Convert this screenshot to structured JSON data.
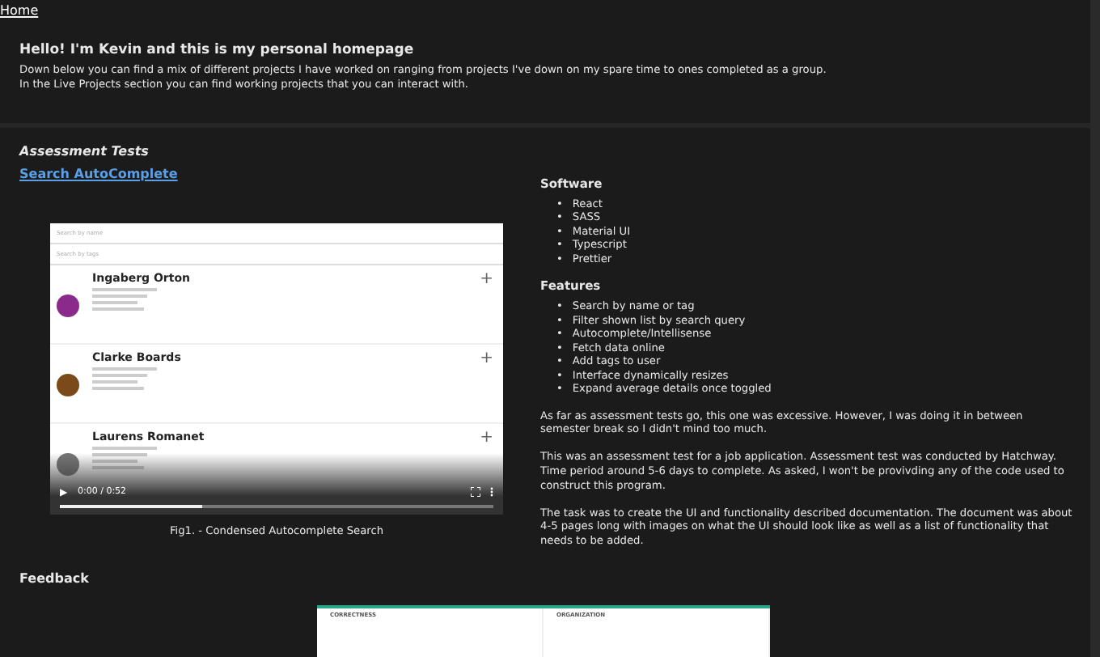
{
  "nav": {
    "home_link": "Home"
  },
  "intro": {
    "heading": "Hello! I'm Kevin and this is my personal homepage",
    "lines": [
      "Down below you can find a mix of different projects I have worked on ranging from projects I've down on my spare time to ones completed as a group.",
      "In the Live Projects section you can find working projects that you can interact with."
    ]
  },
  "section": {
    "title": "Assessment Tests",
    "project_link": "Search AutoComplete"
  },
  "video": {
    "search_fields": [
      {
        "placeholder": "Search by name"
      },
      {
        "placeholder": "Search by tags"
      }
    ],
    "people": [
      {
        "name": "Ingaberg Orton",
        "color": "#8a2a8a"
      },
      {
        "name": "Clarke Boards",
        "color": "#7a4a1a"
      },
      {
        "name": "Laurens Romanet",
        "color": "#777777"
      }
    ],
    "add_symbol": "+",
    "play_symbol": "▶",
    "time": "0:00 / 0:52",
    "level": 0.33,
    "caption": "Fig1. - Condensed Autocomplete Search"
  },
  "software": {
    "title": "Software",
    "bullet": "•",
    "items": [
      "React",
      "SASS",
      "Material UI",
      "Typescript",
      "Prettier"
    ]
  },
  "features": {
    "title": "Features",
    "bullet": "•",
    "items": [
      "Search by name or tag",
      "Filter shown list by search query",
      "Autocomplete/Intellisense",
      "Fetch data online",
      "Add tags to user",
      "Interface dynamically resizes",
      "Expand average details once toggled"
    ]
  },
  "paragraphs": [
    "As far as assessment tests go, this one was excessive. However, I was doing it in between semester break so I didn't mind too much.",
    "This was an assessment test for a job application. Assessment test was conducted by Hatchway. Time period around 5-6 days to complete. As asked, I won't be provivding any of the code used to construct this program.",
    "The task was to create the UI and functionality described documentation. The document was about 4-5 pages long with images on what the UI should look like as well as a list of functionality that needs to be added."
  ],
  "feedback": {
    "title": "Feedback",
    "panels": [
      "CORRECTNESS",
      "ORGANIZATION"
    ]
  }
}
